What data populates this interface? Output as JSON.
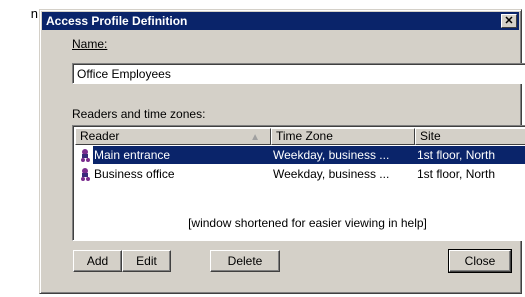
{
  "edge_text": "n",
  "dialog": {
    "title": "Access Profile Definition",
    "close_glyph": "✕"
  },
  "name_field": {
    "label": "Name:",
    "value": "Office Employees"
  },
  "readers": {
    "label": "Readers and time zones:",
    "columns": [
      "Reader",
      "Time Zone",
      "Site"
    ],
    "sort_indicator": "▲",
    "rows": [
      {
        "reader": "Main entrance",
        "time_zone": "Weekday, business ...",
        "site": "1st floor, North",
        "selected": true
      },
      {
        "reader": "Business office",
        "time_zone": "Weekday, business ...",
        "site": "1st floor, North",
        "selected": false
      }
    ],
    "note": "[window shortened for easier viewing in help]"
  },
  "buttons": {
    "add": "Add",
    "edit": "Edit",
    "delete": "Delete",
    "close": "Close"
  },
  "colors": {
    "titlebar": "#0a246a",
    "face": "#d4d0c8",
    "selection": "#0a246a"
  },
  "icons": {
    "reader": "card-reader-icon"
  }
}
